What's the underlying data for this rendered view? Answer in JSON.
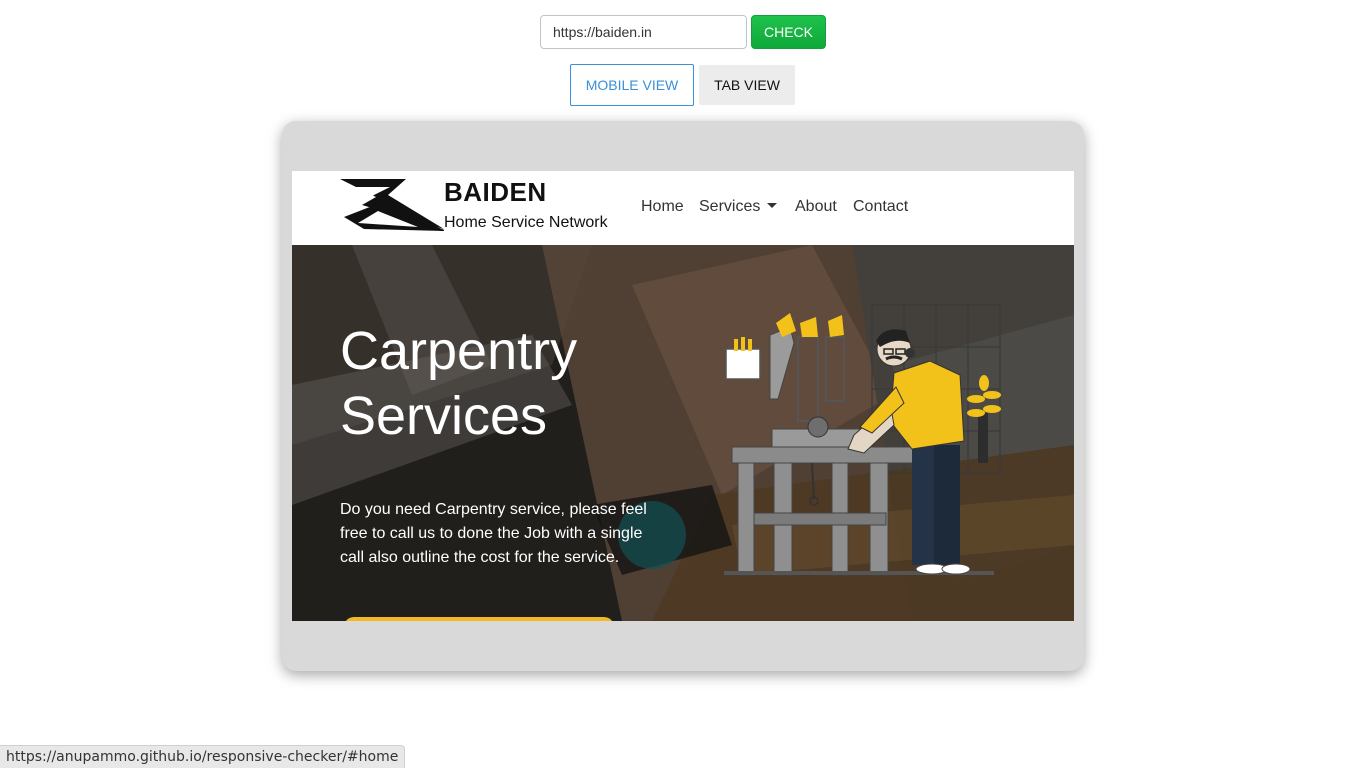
{
  "url_input": {
    "value": "https://baiden.in"
  },
  "check_button": "CHECK",
  "view_buttons": {
    "mobile": "MOBILE VIEW",
    "tab": "TAB VIEW"
  },
  "site": {
    "brand_name": "BAIDEN",
    "brand_tagline": "Home Service Network",
    "nav": {
      "home": "Home",
      "services": "Services",
      "about": "About",
      "contact": "Contact"
    },
    "hero": {
      "title": "Carpentry Services",
      "description": "Do you need Carpentry service, please feel free to call us to done the Job with a single call also outline the cost for the service."
    }
  },
  "status_bar": "https://anupammo.github.io/responsive-checker/#home",
  "colors": {
    "check_green": "#1ec24b",
    "mobile_view_blue": "#3a8fd8",
    "illustration_yellow": "#f2c21b",
    "frame_gray": "#d9d9d9"
  },
  "icons": [
    "baiden-logo-icon",
    "dropdown-caret-icon",
    "carpenter-illustration"
  ]
}
